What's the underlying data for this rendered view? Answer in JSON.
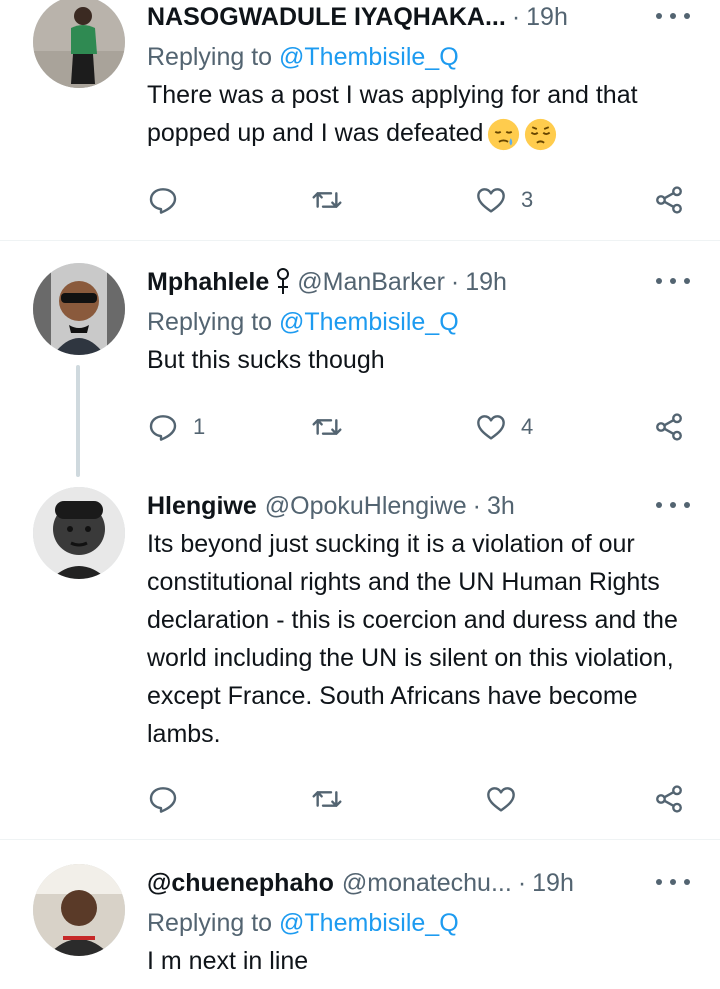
{
  "tweets": [
    {
      "name": "NASOGWADULE IYAQHAKA...",
      "handle": "",
      "time": "19h",
      "replying_prefix": "Replying to",
      "replying_to": "@Thembisile_Q",
      "text": "There was a post I was applying for and that popped up and I was defeated",
      "reply_count": "",
      "retweet_count": "",
      "like_count": "3"
    },
    {
      "name": "Mphahlele",
      "handle": "@ManBarker",
      "time": "19h",
      "replying_prefix": "Replying to",
      "replying_to": "@Thembisile_Q",
      "text": "But this sucks though",
      "reply_count": "1",
      "retweet_count": "",
      "like_count": "4"
    },
    {
      "name": "Hlengiwe",
      "handle": "@OpokuHlengiwe",
      "time": "3h",
      "text": "Its beyond just sucking it is a violation of our constitutional rights and the UN Human Rights declaration - this is coercion and duress and the world including the UN is silent on this violation, except France. South Africans have become lambs.",
      "reply_count": "",
      "retweet_count": "",
      "like_count": ""
    },
    {
      "name": "@chuenephaho",
      "handle": "@monatechu...",
      "time": "19h",
      "replying_prefix": "Replying to",
      "replying_to": "@Thembisile_Q",
      "text": "I m next in line"
    }
  ],
  "dot_separator": "·",
  "colors": {
    "text": "#0f1419",
    "secondary": "#536471",
    "link": "#1d9bf0",
    "divider": "#eff3f4",
    "thread_line": "#cfd9de"
  },
  "icons": {
    "reply": "speech-bubble-icon",
    "retweet": "retweet-icon",
    "like": "heart-icon",
    "share": "share-icon",
    "more": "ellipsis-icon"
  }
}
